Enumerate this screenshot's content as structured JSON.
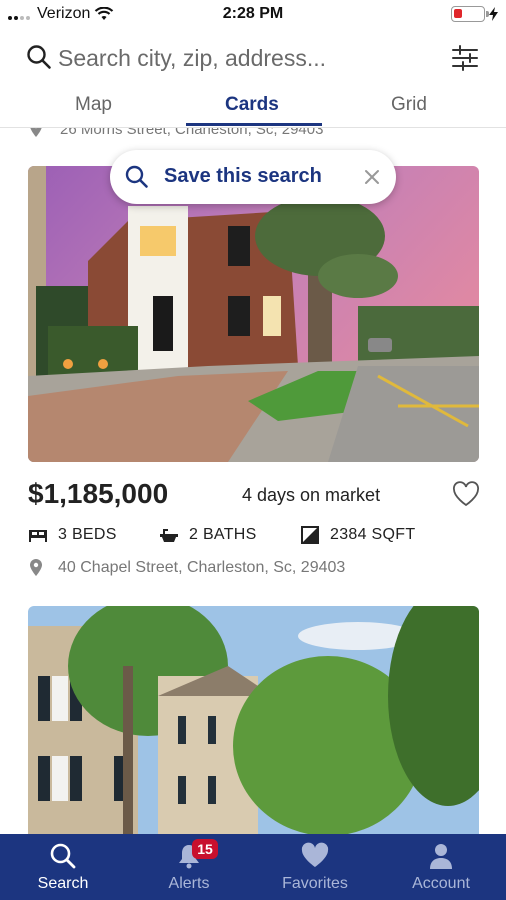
{
  "status_bar": {
    "carrier": "Verizon",
    "time": "2:28 PM",
    "battery_color": "#e0262b"
  },
  "search": {
    "placeholder": "Search city, zip, address...",
    "search_icon": "search-icon",
    "filter_icon": "filter-sliders-icon"
  },
  "tabs": [
    {
      "label": "Map",
      "active": false
    },
    {
      "label": "Cards",
      "active": true
    },
    {
      "label": "Grid",
      "active": false
    }
  ],
  "previous_listing": {
    "address": "26 Morris Street, Charleston, Sc, 29403"
  },
  "save_search": {
    "label": "Save this search"
  },
  "listings": [
    {
      "price": "$1,185,000",
      "days_on_market": "4 days on market",
      "beds": "3 BEDS",
      "baths": "2 BATHS",
      "sqft": "2384 SQFT",
      "address": "40 Chapel Street, Charleston, Sc, 29403"
    }
  ],
  "bottom_nav": [
    {
      "label": "Search",
      "icon": "search-icon",
      "active": true
    },
    {
      "label": "Alerts",
      "icon": "bell-icon",
      "active": false,
      "badge": "15"
    },
    {
      "label": "Favorites",
      "icon": "heart-icon",
      "active": false
    },
    {
      "label": "Account",
      "icon": "person-icon",
      "active": false
    }
  ],
  "colors": {
    "brand": "#1c3580",
    "badge": "#c8102e"
  }
}
